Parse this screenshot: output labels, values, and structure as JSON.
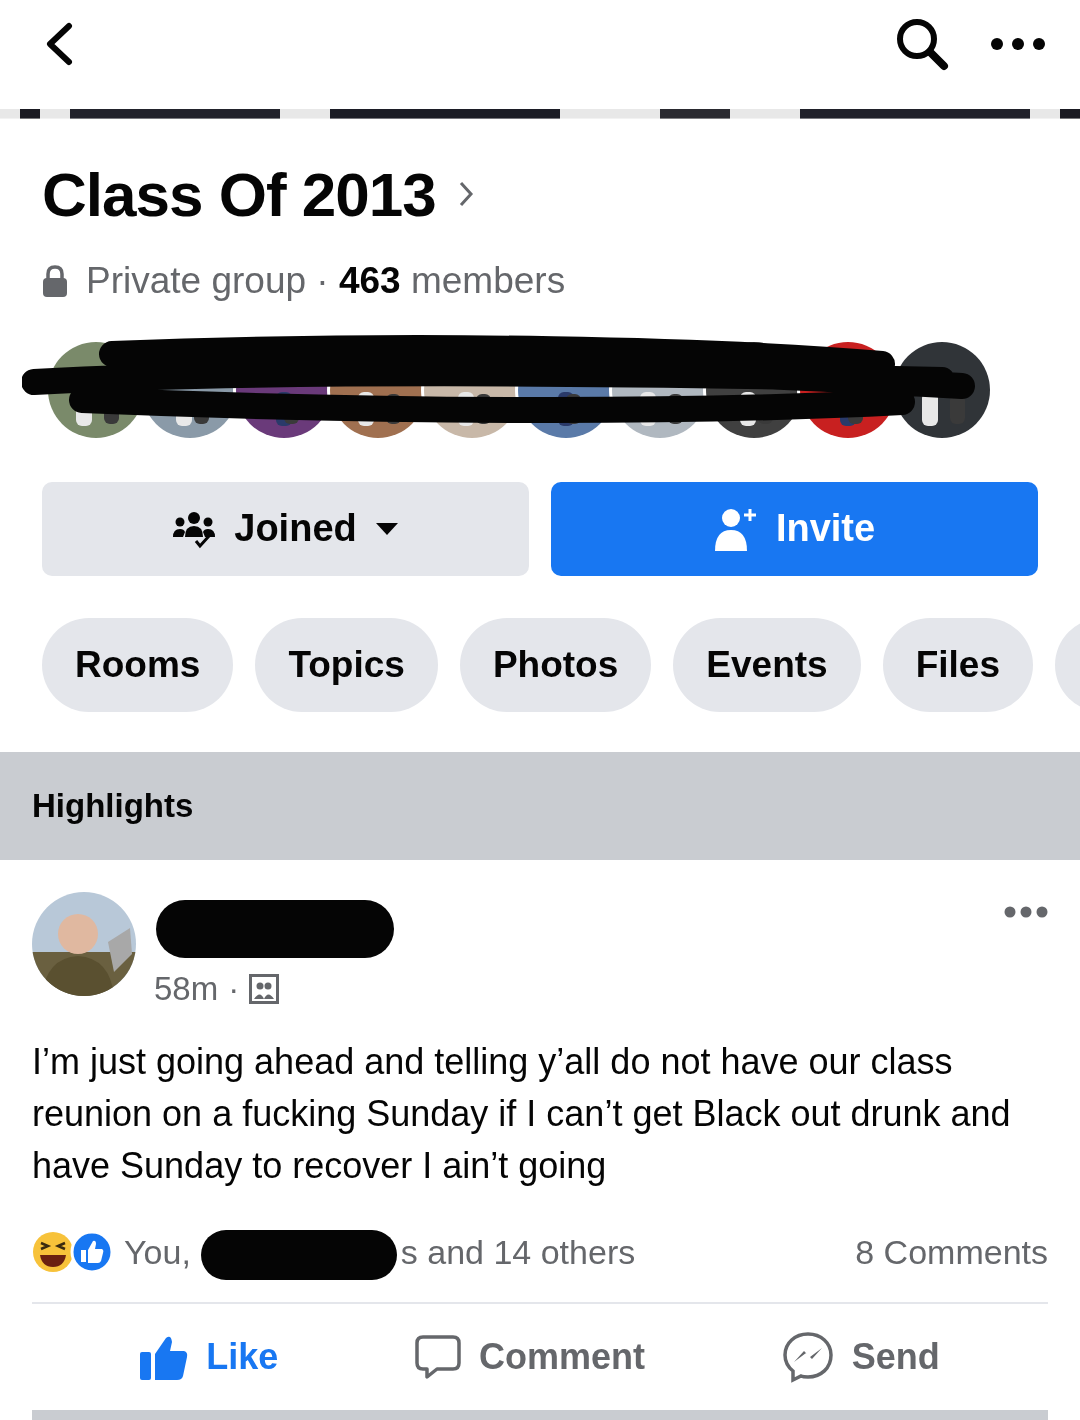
{
  "group": {
    "title": "Class Of 2013",
    "meta": "Private group · **463** members"
  },
  "buttons": [
    {
      "label": "Joined",
      "kind": "joined"
    },
    {
      "label": "Invite",
      "kind": "invite"
    }
  ],
  "chips": [
    "Rooms",
    "Topics",
    "Photos",
    "Events",
    "Files"
  ],
  "section": "Highlights",
  "post": {
    "time": "58m",
    "separator": "·",
    "body": "I’m just going ahead and telling y’all do not have our class reunion on a fucking Sunday if I can’t get Black out drunk and have Sunday to recover I ain’t going",
    "reactions_before": "You,",
    "reactions_after": "s and 14 others",
    "comments": "8 Comments",
    "actions": [
      {
        "label": "Like",
        "kind": "like",
        "selected": true
      },
      {
        "label": "Comment",
        "kind": "comment",
        "selected": false
      },
      {
        "label": "Send",
        "kind": "send",
        "selected": false
      }
    ]
  }
}
